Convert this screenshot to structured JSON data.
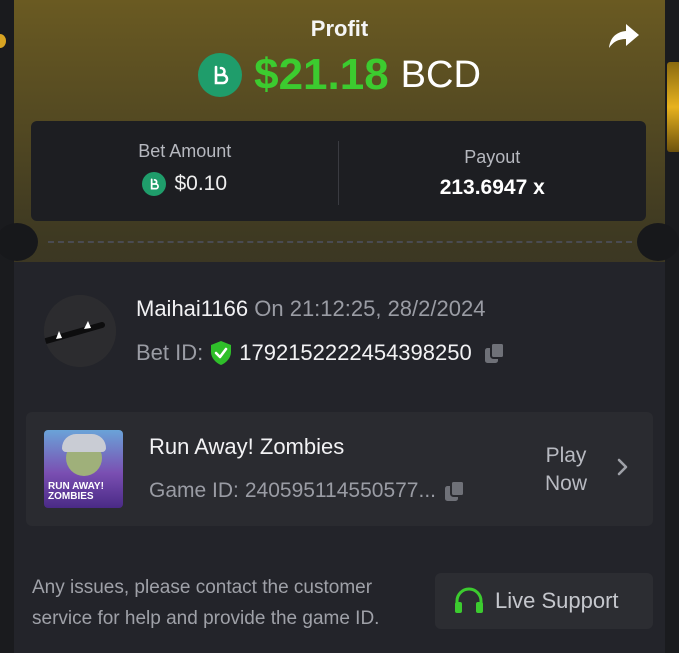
{
  "profit": {
    "label": "Profit",
    "amount": "$21.18",
    "currency": "BCD",
    "coin_icon": "bcd-coin-icon",
    "amount_color": "#3ccb2f"
  },
  "share_icon": "share-arrow-icon",
  "bet_amount": {
    "label": "Bet Amount",
    "value": "$0.10"
  },
  "payout": {
    "label": "Payout",
    "value": "213.6947 x"
  },
  "user": {
    "username": "Maihai1166",
    "timestamp": "On 21:12:25, 28/2/2024",
    "bet_id_label": "Bet ID:",
    "bet_id": "1792152222454398250",
    "verified_icon": "shield-check-icon"
  },
  "game": {
    "title": "Run Away! Zombies",
    "thumb_text_1": "RUN AWAY!",
    "thumb_text_2": "ZOMBIES",
    "game_id_label": "Game ID:",
    "game_id": "240595114550577...",
    "play_label_1": "Play",
    "play_label_2": "Now"
  },
  "footer": {
    "text": "Any issues, please contact the customer service for help and provide the game ID.",
    "support_label": "Live Support",
    "support_icon": "headset-icon",
    "support_color": "#3ccb2f"
  }
}
